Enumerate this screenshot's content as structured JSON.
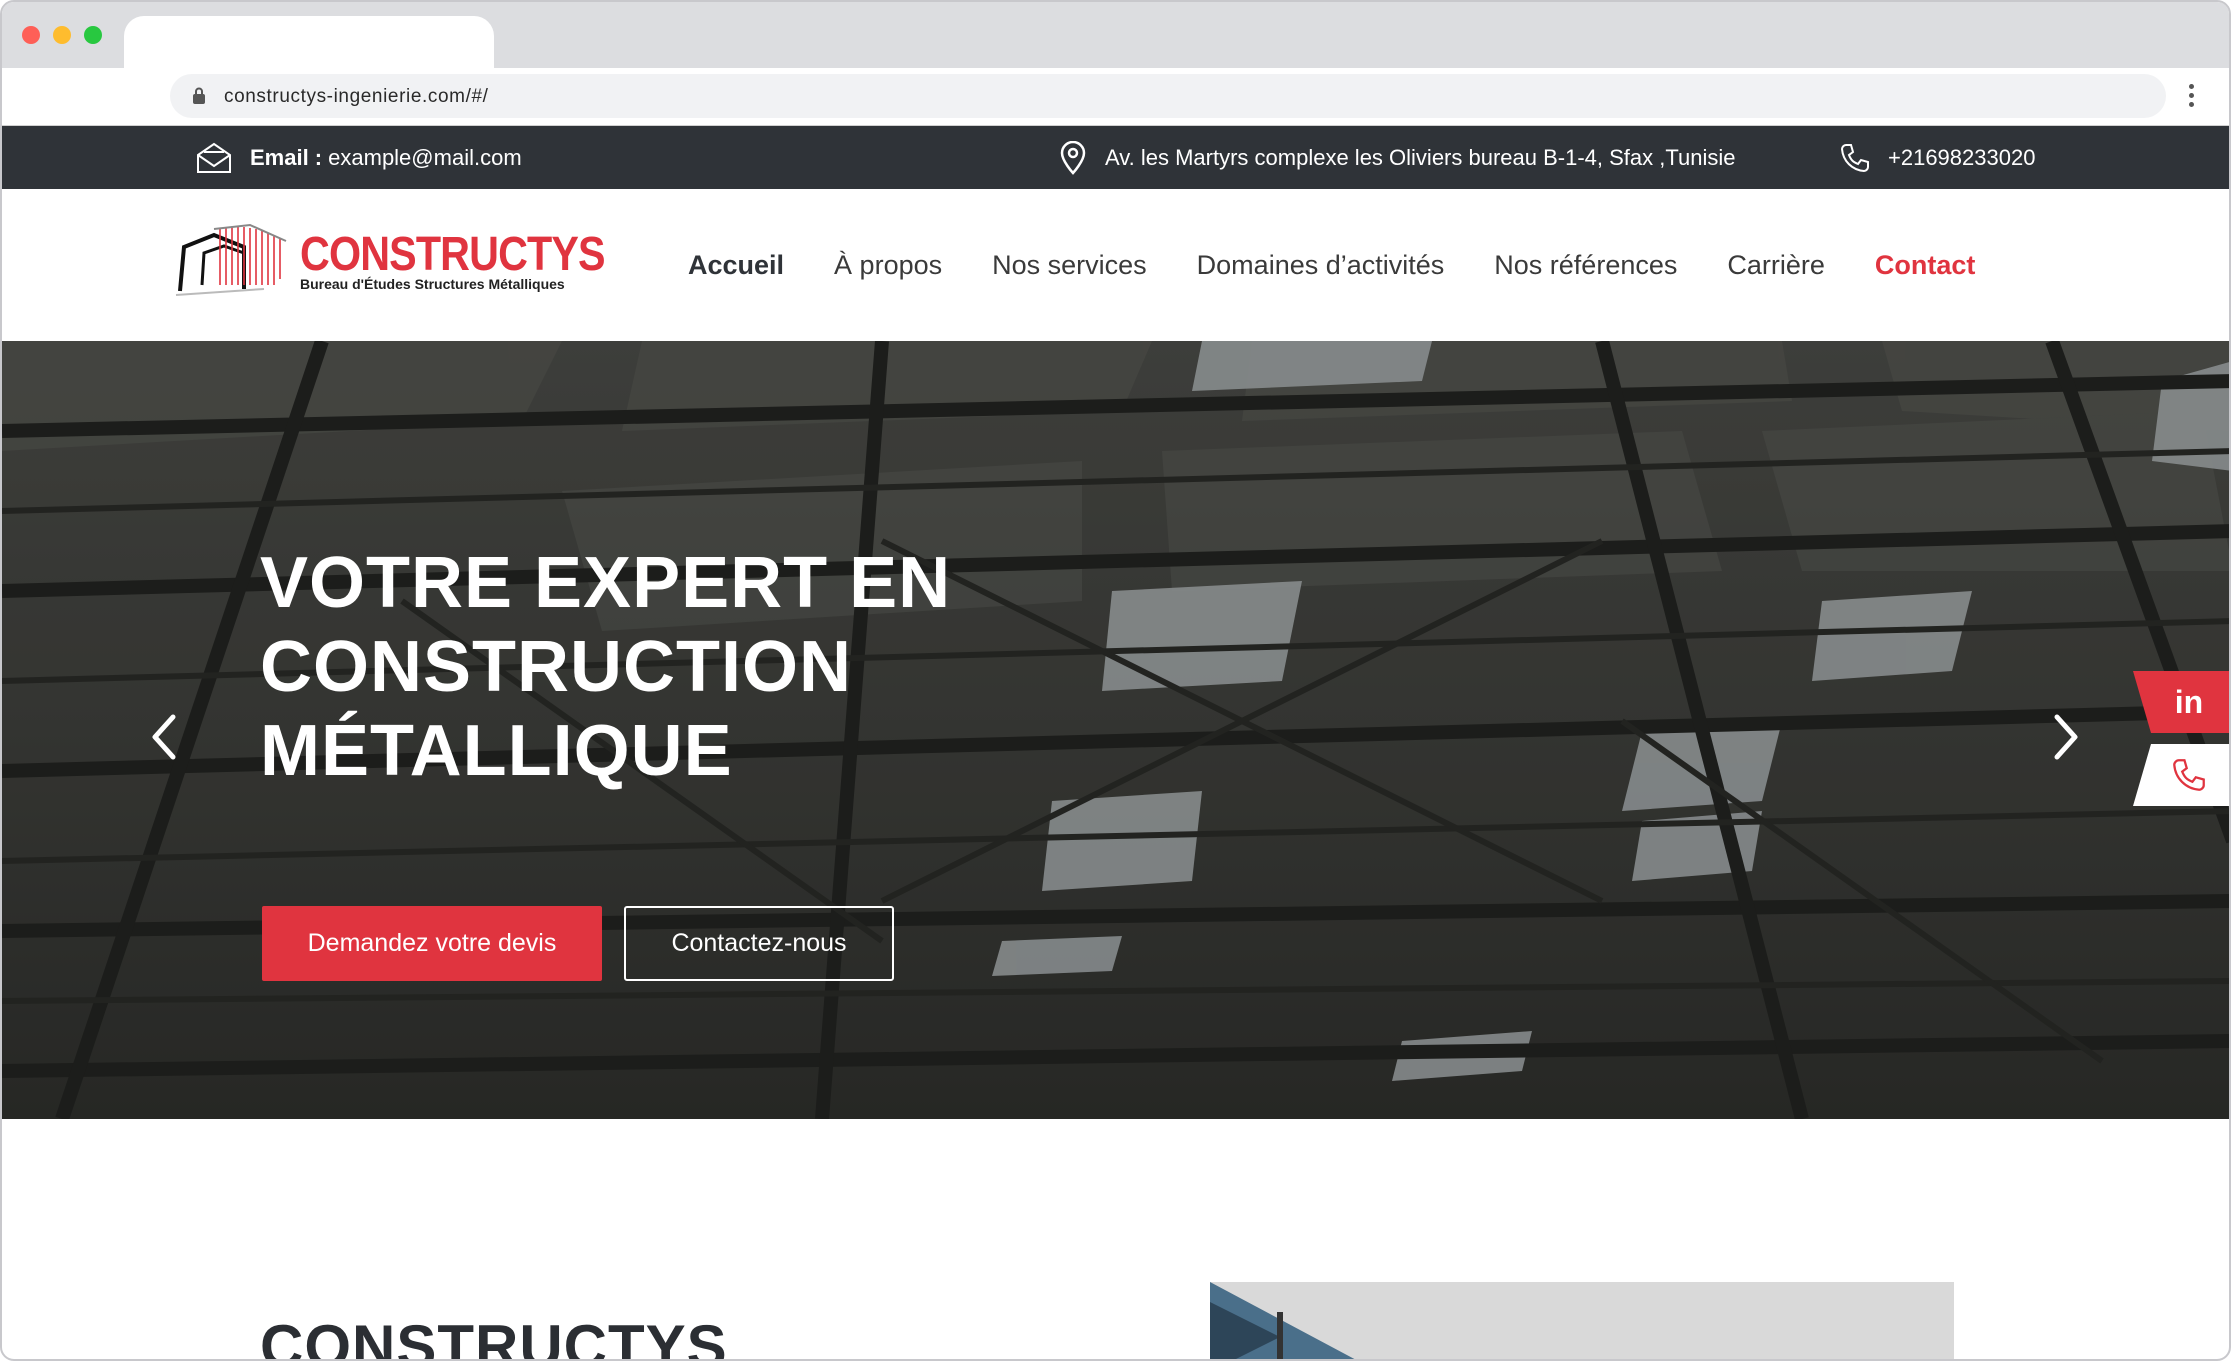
{
  "browser": {
    "url": "constructys-ingenierie.com/#/"
  },
  "topbar": {
    "email_label": "Email :",
    "email_value": "example@mail.com",
    "address": "Av. les Martyrs complexe les Oliviers  bureau B-1-4, Sfax ,Tunisie",
    "phone": "+21698233020"
  },
  "logo": {
    "name": "CONSTRUCTYS",
    "tagline": "Bureau d'Études Structures Métalliques"
  },
  "nav": {
    "items": [
      {
        "label": "Accueil"
      },
      {
        "label": "À propos"
      },
      {
        "label": "Nos services"
      },
      {
        "label": "Domaines d’activités"
      },
      {
        "label": "Nos références"
      },
      {
        "label": "Carrière"
      },
      {
        "label": "Contact"
      }
    ]
  },
  "hero": {
    "title_line1": "VOTRE EXPERT EN",
    "title_line2": "CONSTRUCTION",
    "title_line3": "MÉTALLIQUE",
    "cta_primary": "Demandez votre devis",
    "cta_secondary": "Contactez-nous"
  },
  "social": {
    "linkedin_text": "in"
  },
  "section": {
    "title": "CONSTRUCTYS"
  },
  "colors": {
    "accent": "#e0343f",
    "dark": "#2f3338"
  },
  "icons": [
    "lock-icon",
    "kebab-menu-icon",
    "envelope-icon",
    "location-pin-icon",
    "phone-icon",
    "chevron-left-icon",
    "chevron-right-icon",
    "linkedin-icon"
  ]
}
